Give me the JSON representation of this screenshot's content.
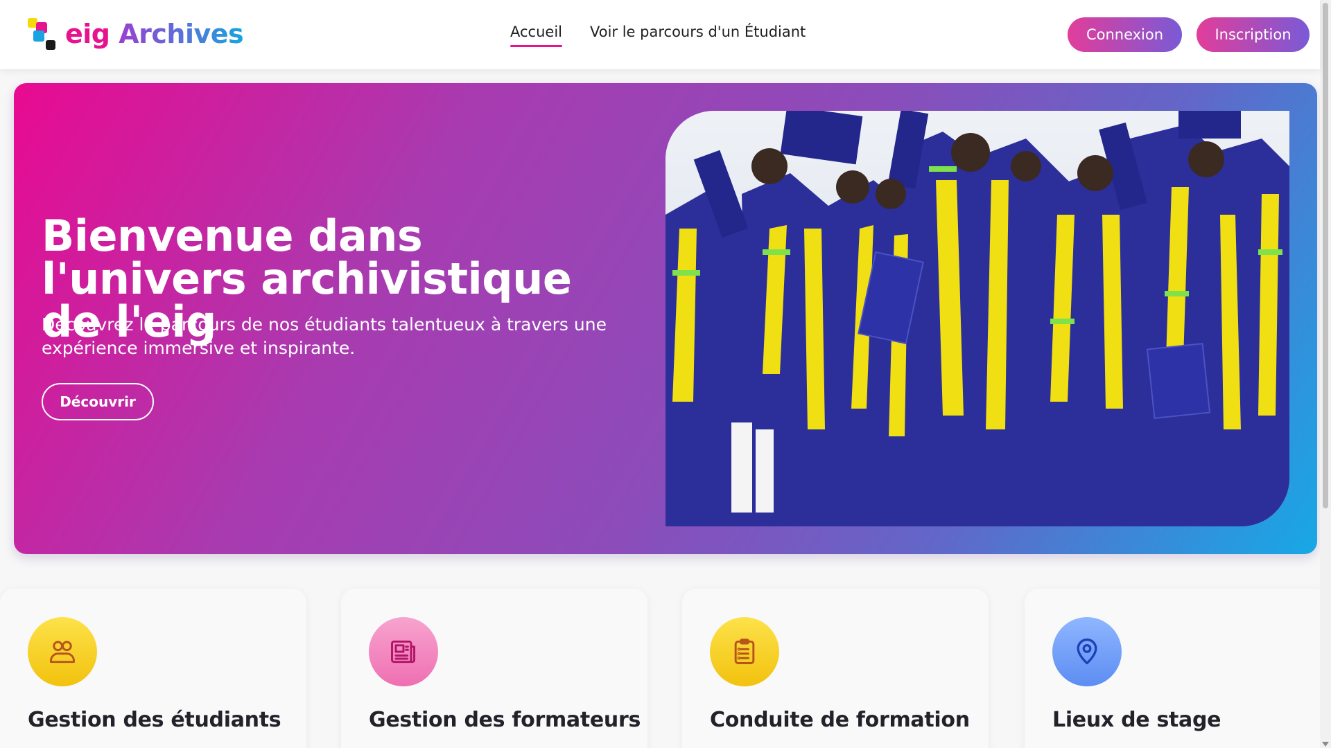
{
  "brand": {
    "name_part1": "eig",
    "name_part2": "Archives"
  },
  "nav": {
    "home": "Accueil",
    "journey": "Voir le parcours d'un Étudiant"
  },
  "auth": {
    "login": "Connexion",
    "signup": "Inscription"
  },
  "hero": {
    "title": "Bienvenue dans l'univers archivistique de l'eig",
    "subtitle": "Découvrez le parcours de nos étudiants talentueux à travers une expérience immersive et inspirante.",
    "cta": "Découvrir"
  },
  "cards": [
    {
      "title": "Gestion des étudiants",
      "icon": "users-icon",
      "color": "#f5cc1c"
    },
    {
      "title": "Gestion des formateurs",
      "icon": "newspaper-icon",
      "color": "#ef79b6"
    },
    {
      "title": "Conduite de formation",
      "icon": "clipboard-list-icon",
      "color": "#f5cc1c"
    },
    {
      "title": "Lieux de stage",
      "icon": "map-pin-icon",
      "color": "#6b97f4"
    }
  ],
  "colors": {
    "accent": "#e7128e",
    "blue": "#17a4e0",
    "purple": "#8c4cba"
  }
}
